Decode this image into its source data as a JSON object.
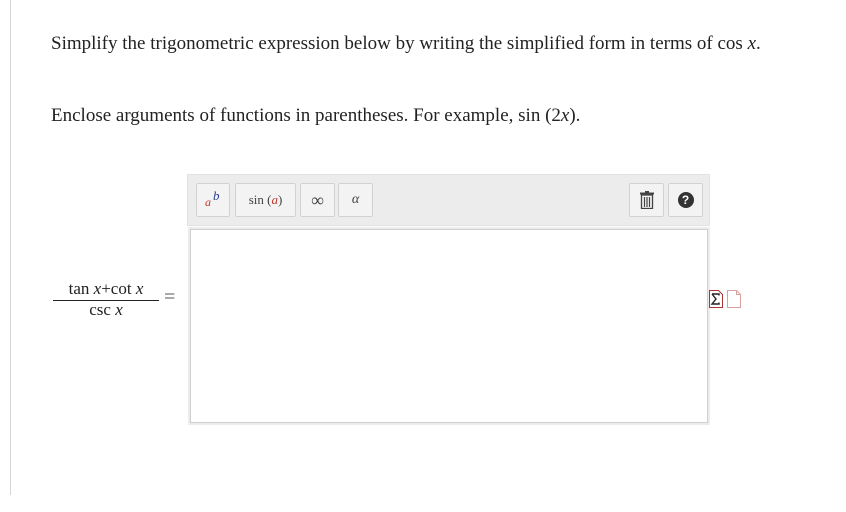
{
  "instructions": {
    "p1_text": "Simplify the trigonometric expression below by writing the simplified form in terms of",
    "p1_fn": "cos",
    "p1_var": "x",
    "p1_end": ".",
    "p2_text": "Enclose arguments of functions in parentheses. For example,",
    "p2_fn": "sin",
    "p2_arg_open": "(2",
    "p2_arg_var": "x",
    "p2_arg_close": ").",
    "space": " "
  },
  "toolbar": {
    "power_base": "a",
    "power_exp": "b",
    "sin_label": "sin (",
    "sin_var": "a",
    "sin_close": ")",
    "infinity": "∞",
    "alpha": "α",
    "trash_icon": "trash-icon",
    "help_icon": "question-circle-icon",
    "help_glyph": "?"
  },
  "answer": {
    "value": ""
  },
  "expression": {
    "numerator_tan": "tan ",
    "numerator_x1": "x",
    "plus": "+",
    "numerator_cot": "cot ",
    "numerator_x2": "x",
    "denominator_csc": "csc ",
    "denominator_x": "x",
    "equals": "="
  },
  "side_icons": [
    "sigma-doc-icon",
    "blank-doc-icon"
  ],
  "colors": {
    "toolbar_bg": "#ececec",
    "accent_red": "#c0392b",
    "accent_blue": "#2a3b8f"
  }
}
